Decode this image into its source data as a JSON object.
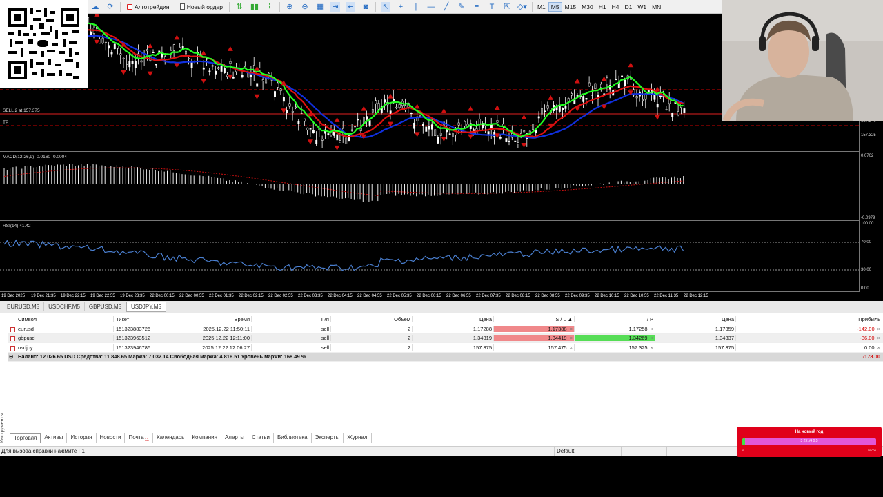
{
  "toolbar": {
    "algo_trading": "Алготрейдинг",
    "new_order": "Новый ордер",
    "timeframes": [
      "M1",
      "M5",
      "M15",
      "M30",
      "H1",
      "H4",
      "D1",
      "W1",
      "MN"
    ],
    "active_timeframe": "M5"
  },
  "chart": {
    "main": {
      "sell_label": "SELL 2 at 157.375",
      "tp_label": "TP",
      "price_labels": [
        "157.340",
        "157.325"
      ]
    },
    "macd": {
      "label": "MACD(12,26,9) -0.0160 -0.0004",
      "axis_top": "0.0702",
      "axis_bottom": "-0.0979"
    },
    "rsi": {
      "label": "RSI(14) 41.42",
      "axis": [
        "100.00",
        "70.00",
        "30.00",
        "0.00"
      ]
    },
    "time_labels": [
      "19 Dec 2025",
      "19 Dec 21:35",
      "19 Dec 22:15",
      "19 Dec 22:55",
      "19 Dec 23:35",
      "22 Dec 00:15",
      "22 Dec 00:55",
      "22 Dec 01:35",
      "22 Dec 02:15",
      "22 Dec 02:55",
      "22 Dec 03:35",
      "22 Dec 04:15",
      "22 Dec 04:55",
      "22 Dec 05:35",
      "22 Dec 06:15",
      "22 Dec 06:55",
      "22 Dec 07:35",
      "22 Dec 08:15",
      "22 Dec 08:55",
      "22 Dec 09:35",
      "22 Dec 10:15",
      "22 Dec 10:55",
      "22 Dec 11:35",
      "22 Dec 12:15"
    ]
  },
  "symbol_tabs": [
    "EURUSD,M5",
    "USDCHF,M5",
    "GBPUSD,M5",
    "USDJPY,M5"
  ],
  "active_symbol_tab": "USDJPY,M5",
  "trade": {
    "headers": {
      "symbol": "Символ",
      "ticket": "Тикет",
      "time": "Время",
      "type": "Тип",
      "volume": "Объем",
      "price": "Цена",
      "sl": "S / L",
      "tp": "T / P",
      "current": "Цена",
      "profit": "Прибыль"
    },
    "rows": [
      {
        "symbol": "eurusd",
        "ticket": "151323883726",
        "time": "2025.12.22 11:50:11",
        "type": "sell",
        "volume": "2",
        "price": "1.17288",
        "sl": "1.17388",
        "tp": "1.17258",
        "current": "1.17359",
        "profit": "-142.00"
      },
      {
        "symbol": "gbpusd",
        "ticket": "151323963512",
        "time": "2025.12.22 12:11:00",
        "type": "sell",
        "volume": "2",
        "price": "1.34319",
        "sl": "1.34419",
        "tp": "1.34269",
        "current": "1.34337",
        "profit": "-36.00"
      },
      {
        "symbol": "usdjpy",
        "ticket": "151323946786",
        "time": "2025.12.22 12:06:27",
        "type": "sell",
        "volume": "2",
        "price": "157.375",
        "sl": "157.475",
        "tp": "157.325",
        "current": "157.375",
        "profit": "0.00"
      }
    ],
    "summary": "Баланс: 12 026.65 USD  Средства: 11 848.65  Маржа: 7 032.14  Свободная маржа: 4 816.51  Уровень маржи: 168.49 %",
    "summary_profit": "-178.00"
  },
  "side_label": "Инструменты",
  "bottom_tabs": [
    "Торговля",
    "Активы",
    "История",
    "Новости",
    "Почта",
    "Календарь",
    "Компания",
    "Алерты",
    "Статьи",
    "Библиотека",
    "Эксперты",
    "Журнал"
  ],
  "mail_badge": "11",
  "status": {
    "help": "Для вызова справки нажмите F1",
    "profile": "Default"
  },
  "promo": {
    "title": "На новый год",
    "bar_text": "3 291/4 0:5",
    "progress": 0.02,
    "low": "0",
    "high": "10 000"
  },
  "colors": {
    "sl_bg": "#f0888a",
    "tp_bg": "#56dd56",
    "loss": "#d20000",
    "ma_green": "#22ff22",
    "ma_red": "#e01010",
    "ma_blue": "#1030e0",
    "rsi_line": "#4a7fd0"
  }
}
